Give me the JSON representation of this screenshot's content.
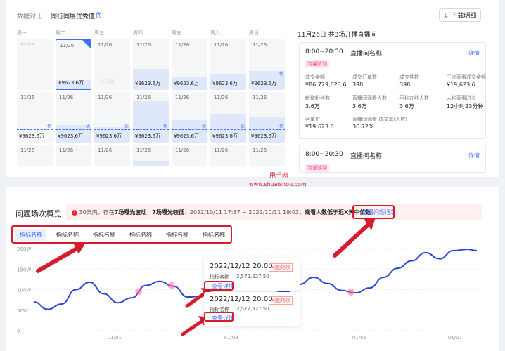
{
  "top": {
    "tab_compare": "数据对比",
    "tab_peer": "同行同层优秀值",
    "badge_you": "优",
    "download_label": "下载明细",
    "weekdays": [
      "周一",
      "周二",
      "周三",
      "周四",
      "周五",
      "周六",
      "周日"
    ],
    "calendar_rows": [
      [
        {
          "date": "11/26",
          "value": "",
          "dim": true,
          "selected": false,
          "fill": 0,
          "you": false
        },
        {
          "date": "11/26",
          "value": "¥9623.6万",
          "dim": false,
          "selected": true,
          "fill": 0.18,
          "you": false
        },
        {
          "date": "11/26",
          "value": "",
          "dim": false,
          "selected": false,
          "fill": 0,
          "you": false,
          "faint_text": "无直播"
        },
        {
          "date": "11/26",
          "value": "¥9623.6万",
          "dim": false,
          "selected": false,
          "fill": 0.42,
          "you": false
        },
        {
          "date": "11/26",
          "value": "¥9623.6万",
          "dim": false,
          "selected": false,
          "fill": 0.25,
          "you": false
        },
        {
          "date": "11/26",
          "value": "¥9623.6万",
          "dim": false,
          "selected": false,
          "fill": 0.3,
          "you": false
        },
        {
          "date": "11/26",
          "value": "¥9623.6万",
          "dim": false,
          "selected": false,
          "fill": 0.38,
          "you": true
        }
      ],
      [
        {
          "date": "11/26",
          "value": "¥9623.6万",
          "dim": false,
          "selected": false,
          "fill": 0.0,
          "you": true
        },
        {
          "date": "11/26",
          "value": "¥9623.6万",
          "dim": false,
          "selected": false,
          "fill": 0.35,
          "you": true
        },
        {
          "date": "11/26",
          "value": "¥9623.6万",
          "dim": false,
          "selected": false,
          "fill": 0.3,
          "you": true
        },
        {
          "date": "11/26",
          "value": "¥9623.6万",
          "dim": false,
          "selected": false,
          "fill": 0.82,
          "you": true
        },
        {
          "date": "11/26",
          "value": "¥9623.6万",
          "dim": false,
          "selected": false,
          "fill": 0.45,
          "you": true
        },
        {
          "date": "11/26",
          "value": "¥9623.6万",
          "dim": false,
          "selected": false,
          "fill": 0.55,
          "you": true
        },
        {
          "date": "11/26",
          "value": "¥9623.6万",
          "dim": false,
          "selected": false,
          "fill": 0.5,
          "you": true
        }
      ],
      [
        {
          "date": "11/26",
          "value": "",
          "dim": false,
          "selected": false,
          "fill": 0,
          "you": false
        },
        {
          "date": "11/26",
          "value": "",
          "dim": false,
          "selected": false,
          "fill": 0,
          "you": false
        },
        {
          "date": "11/26",
          "value": "",
          "dim": false,
          "selected": false,
          "fill": 0,
          "you": false
        },
        {
          "date": "11/26",
          "value": "",
          "dim": false,
          "selected": false,
          "fill": 0.2,
          "you": false
        },
        {
          "date": "11/26",
          "value": "",
          "dim": false,
          "selected": false,
          "fill": 0,
          "you": false
        },
        {
          "date": "11/26",
          "value": "",
          "dim": false,
          "selected": false,
          "fill": 0,
          "you": false
        },
        {
          "date": "11/26",
          "value": "",
          "dim": false,
          "selected": false,
          "fill": 0,
          "you": false
        }
      ]
    ],
    "right_title": "11月26日 共3场开播直播间",
    "card1": {
      "time": "8:00~20:30",
      "room": "直播间名称",
      "detail": "详情",
      "tag": "流量波动",
      "metrics": [
        {
          "label": "成交金额",
          "value": "¥86,729,623.6"
        },
        {
          "label": "成交订单数",
          "value": "398"
        },
        {
          "label": "成交件数",
          "value": "398"
        },
        {
          "label": "千次观看成交金额",
          "value": "¥19,623.6"
        },
        {
          "label": "新增粉丝数",
          "value": "3.6万"
        },
        {
          "label": "直播间观看人数",
          "value": "3.6万"
        },
        {
          "label": "平均在线人数",
          "value": "3.6万"
        },
        {
          "label": "人均观看时长",
          "value": "12小时23分钟"
        },
        {
          "label": "客单价",
          "value": "¥19,623.6"
        },
        {
          "label": "直播间观看-成交率(人数)",
          "value": "36.72%"
        }
      ]
    },
    "card2": {
      "time": "8:00~20:30",
      "room": "直播间名称",
      "detail": "详情",
      "tag": "流量波动"
    }
  },
  "watermark": {
    "line1": "甩手网",
    "line2": "www.shuaishou.com"
  },
  "bottom": {
    "title": "问题场次概览",
    "alert": {
      "icon": "!",
      "prefix": "30天内，存在",
      "bold1": "7场曝光波动",
      "mid": "，",
      "bold2": "7场曝光较低",
      "range": "：2022/10/11 17:37 ~ 2022/10/11 19:03，",
      "tail": "观看人数低于近X天中位数",
      "link": "查看问题场次"
    },
    "metric_tabs": [
      "指标名称",
      "指标名称",
      "指标名称",
      "指标名称",
      "指标名称",
      "指标名称"
    ],
    "tooltips": [
      {
        "datetime": "2022/12/12 20:00",
        "badge": "问题场次",
        "label": "指标名称",
        "value": "2,572,527.50",
        "link": "查看详情"
      },
      {
        "datetime": "2022/12/12 20:00",
        "badge": "问题场次",
        "label": "指标名称",
        "value": "2,572,527.50",
        "link": "查看详情"
      }
    ]
  },
  "chart_data": {
    "type": "line",
    "title": "",
    "xlabel": "",
    "ylabel": "",
    "y_ticks": [
      "200W",
      "150W",
      "100W",
      "50W",
      "0"
    ],
    "x_ticks": [
      "01/01",
      "01/03",
      "01/05",
      "01/07"
    ],
    "ylim": [
      0,
      200
    ],
    "grid": true,
    "series": [
      {
        "x": [
          0,
          0.6,
          1.2,
          1.8,
          2.4,
          3.0,
          3.6,
          4.2,
          4.8,
          5.4,
          6.0,
          6.6,
          7.2,
          7.8,
          8.4,
          9.0,
          9.6,
          10.2,
          10.8,
          11.4,
          12.0,
          12.6,
          13.2,
          13.8,
          14.4,
          15.0,
          15.6,
          16.2,
          16.8,
          17.4,
          18.0,
          18.6,
          19.0
        ],
        "y": [
          70,
          52,
          65,
          100,
          118,
          90,
          68,
          80,
          110,
          120,
          108,
          82,
          84,
          110,
          128,
          125,
          108,
          98,
          94,
          113,
          130,
          115,
          98,
          92,
          104,
          130,
          152,
          170,
          190,
          175,
          195,
          198,
          195
        ]
      }
    ],
    "problem_points": [
      4.5,
      5.9,
      7.6,
      13.6
    ]
  }
}
